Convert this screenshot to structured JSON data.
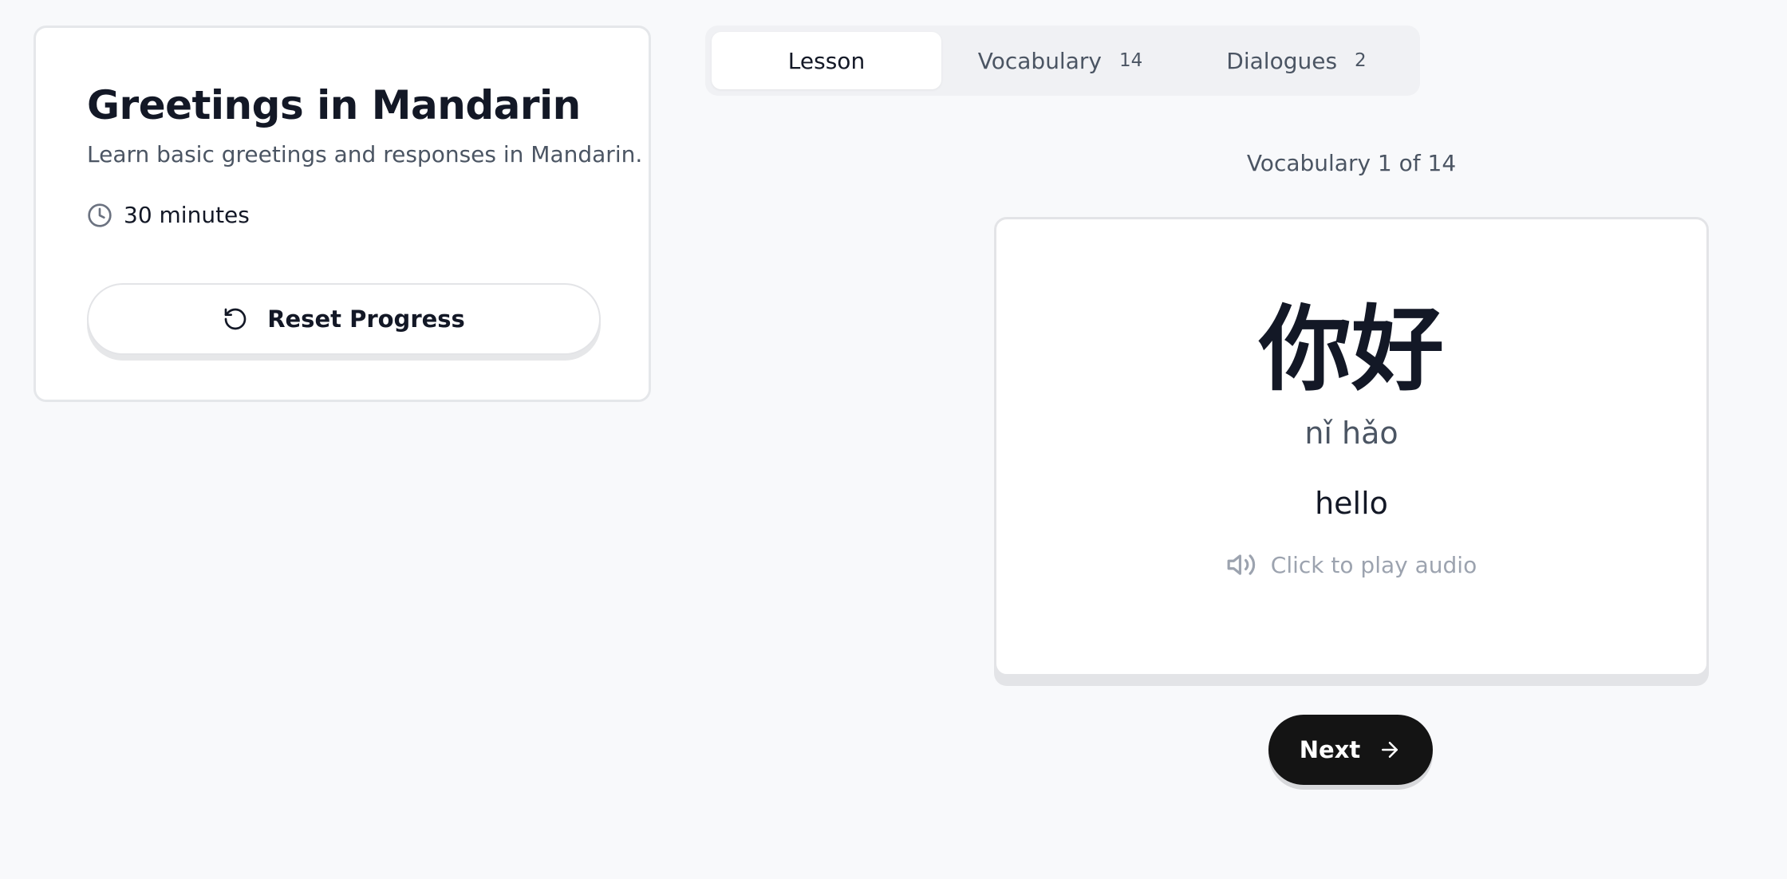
{
  "lesson": {
    "title": "Greetings in Mandarin",
    "description": "Learn basic greetings and responses in Mandarin.",
    "duration": "30 minutes",
    "reset_label": "Reset Progress"
  },
  "tabs": [
    {
      "label": "Lesson",
      "count": "",
      "active": true
    },
    {
      "label": "Vocabulary",
      "count": "14",
      "active": false
    },
    {
      "label": "Dialogues",
      "count": "2",
      "active": false
    }
  ],
  "counter": "Vocabulary 1 of 14",
  "card": {
    "hanzi": "你好",
    "pinyin": "nǐ hǎo",
    "meaning": "hello",
    "audio_label": "Click to play audio"
  },
  "next_label": "Next",
  "icons": {
    "duration": "clock-icon",
    "reset": "refresh-icon",
    "audio": "speaker-icon",
    "next": "arrow-right-icon"
  },
  "colors": {
    "background": "#f8f9fb",
    "primary_text": "#131826",
    "muted_text": "#4b5563",
    "faint_text": "#9ca3af",
    "next_button": "#141414"
  }
}
